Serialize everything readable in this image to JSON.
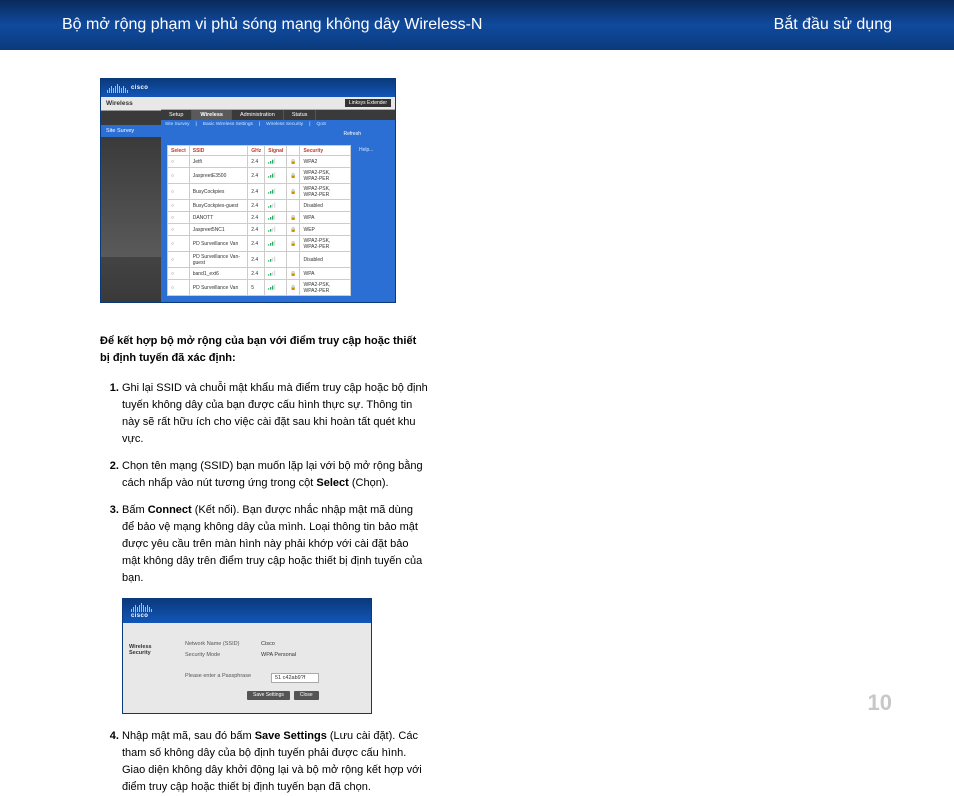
{
  "header": {
    "left": "Bộ mở rộng phạm vi phủ sóng mạng không dây Wireless-N",
    "right": "Bắt đầu sử dụng"
  },
  "fig1": {
    "brand": "cisco",
    "sidebar_label": "Wireless",
    "sidebar_sub": "Site Survey",
    "firmware": "Linksys Extender",
    "tabs": {
      "setup": "Setup",
      "wireless": "Wireless",
      "admin": "Administration",
      "status": "Status"
    },
    "subtabs": {
      "site": "Site Survey",
      "basic": "Basic Wireless Settings",
      "security": "Wireless Security",
      "qos": "QoS"
    },
    "refresh": "Refresh",
    "help": "Help...",
    "cols": {
      "select": "Select",
      "ssid": "SSID",
      "ghz": "GHz",
      "signal": "Signal",
      "security": "Security"
    },
    "rows": [
      {
        "ssid": "Jetfi",
        "ghz": "2.4",
        "sig": 3,
        "lock": true,
        "sec": "WPA2"
      },
      {
        "ssid": "JaspreetE3500",
        "ghz": "2.4",
        "sig": 3,
        "lock": true,
        "sec": "WPA2-PSK, WPA2-PER"
      },
      {
        "ssid": "BusyCockpies",
        "ghz": "2.4",
        "sig": 3,
        "lock": true,
        "sec": "WPA2-PSK, WPA2-PER"
      },
      {
        "ssid": "BusyCockpies-guest",
        "ghz": "2.4",
        "sig": 2,
        "lock": false,
        "sec": "Disabled"
      },
      {
        "ssid": "DANOTT",
        "ghz": "2.4",
        "sig": 3,
        "lock": true,
        "sec": "WPA"
      },
      {
        "ssid": "Jaspreet5NC1",
        "ghz": "2.4",
        "sig": 2,
        "lock": true,
        "sec": "WEP"
      },
      {
        "ssid": "PD Surveillance Van",
        "ghz": "2.4",
        "sig": 3,
        "lock": true,
        "sec": "WPA2-PSK, WPA2-PER"
      },
      {
        "ssid": "PD Surveillance Van-guest",
        "ghz": "2.4",
        "sig": 2,
        "lock": false,
        "sec": "Disabled"
      },
      {
        "ssid": "band1_ext6",
        "ghz": "2.4",
        "sig": 2,
        "lock": true,
        "sec": "WPA"
      },
      {
        "ssid": "PD Surveillance Van",
        "ghz": "5",
        "sig": 3,
        "lock": true,
        "sec": "WPA2-PSK, WPA2-PER"
      }
    ]
  },
  "intro": "Để kết hợp bộ mở rộng của bạn với điểm truy cập hoặc thiết bị định tuyến đã xác định:",
  "steps": {
    "s1": "Ghi lại SSID và chuỗi mật khẩu mà điểm truy cập hoặc bộ định tuyến không dây của bạn được cấu hình thực sự. Thông tin này sẽ rất hữu ích cho việc cài đặt sau khi hoàn tất quét khu vực.",
    "s2a": "Chọn tên mạng (SSID) bạn muốn lặp lại với bộ mở rộng bằng cách nhấp vào nút tương ứng trong cột ",
    "s2b": "Select",
    "s2c": " (Chọn).",
    "s3a": "Bấm ",
    "s3b": "Connect",
    "s3c": " (Kết nối). Bạn được nhắc nhập mật mã dùng để bảo vệ mạng không dây của mình. Loại thông tin bảo mật được yêu cầu trên màn hình này phải khớp với cài đặt bảo mật không dây trên điểm truy cập hoặc thiết bị định tuyến của bạn.",
    "s4a": "Nhập mật mã, sau đó bấm ",
    "s4b": "Save Settings",
    "s4c": " (Lưu cài đặt). Các tham số không dây của bộ định tuyến phải được cấu hình. Giao diện không dây khởi động lại và bộ mở rộng kết hợp với điểm truy cập hoặc thiết bị định tuyến bạn đã chọn."
  },
  "fig2": {
    "brand": "cisco",
    "sidebar_label": "Wireless Security",
    "form": {
      "ssid_label": "Network Name (SSID)",
      "ssid_val": "Cisco",
      "mode_label": "Security Mode",
      "mode_val": "WPA Personal",
      "pass_label": "Please enter a Passphrase",
      "pass_val": "51 c42ab9?f"
    },
    "btn_save": "Save Settings",
    "btn_close": "Close"
  },
  "page_number": "10"
}
